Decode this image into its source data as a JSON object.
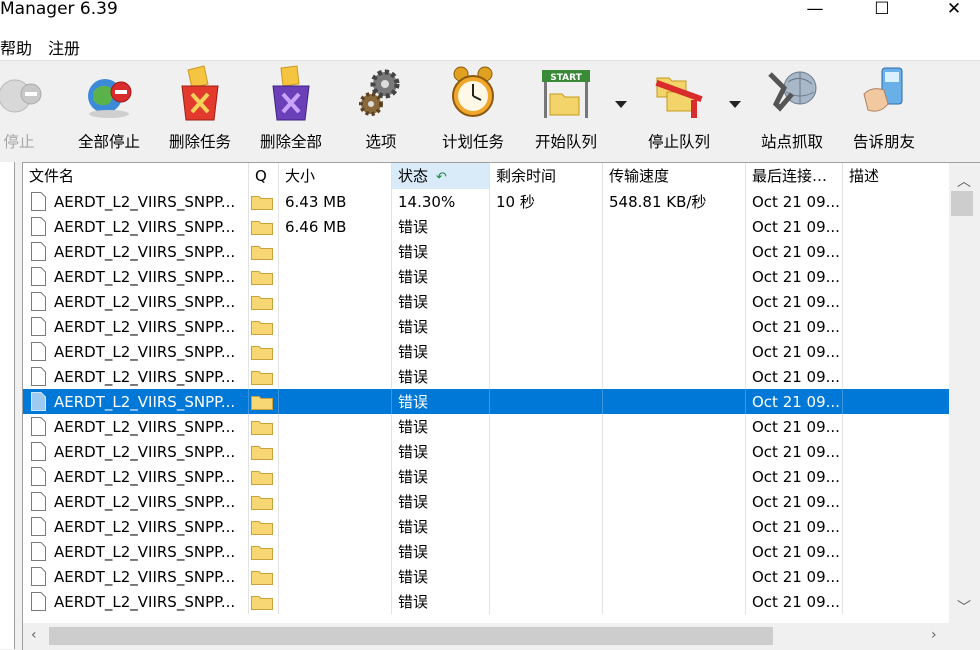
{
  "window": {
    "title": "Manager 6.39",
    "minimize": "—",
    "maximize": "☐",
    "close": "✕"
  },
  "menu": [
    "帮助",
    "注册"
  ],
  "toolbar": [
    {
      "label": "停止",
      "icon": "stop-icon",
      "enabled": false
    },
    {
      "label": "全部停止",
      "icon": "stop-all-icon",
      "enabled": true
    },
    {
      "label": "删除任务",
      "icon": "delete-task-icon",
      "enabled": true
    },
    {
      "label": "删除全部",
      "icon": "delete-all-icon",
      "enabled": true
    },
    {
      "label": "选项",
      "icon": "gear-icon",
      "enabled": true
    },
    {
      "label": "计划任务",
      "icon": "alarm-clock-icon",
      "enabled": true
    },
    {
      "label": "开始队列",
      "icon": "start-queue-icon",
      "enabled": true,
      "icon_text": "START"
    },
    {
      "label": "停止队列",
      "icon": "stop-queue-icon",
      "enabled": true
    },
    {
      "label": "站点抓取",
      "icon": "site-grabber-icon",
      "enabled": true
    },
    {
      "label": "告诉朋友",
      "icon": "tell-friend-icon",
      "enabled": true
    }
  ],
  "columns": [
    "文件名",
    "Q",
    "大小",
    "状态",
    "剩余时间",
    "传输速度",
    "最后连接…",
    "描述"
  ],
  "rows": [
    {
      "name": "AERDT_L2_VIIRS_SNPP...",
      "size": "6.43  MB",
      "status": "14.30%",
      "remaining": "10 秒",
      "speed": "548.81  KB/秒",
      "last": "Oct 21 09...",
      "desc": "",
      "selected": false
    },
    {
      "name": "AERDT_L2_VIIRS_SNPP...",
      "size": "6.46  MB",
      "status": "错误",
      "remaining": "",
      "speed": "",
      "last": "Oct 21 09...",
      "desc": "",
      "selected": false
    },
    {
      "name": "AERDT_L2_VIIRS_SNPP...",
      "size": "",
      "status": "错误",
      "remaining": "",
      "speed": "",
      "last": "Oct 21 09...",
      "desc": "",
      "selected": false
    },
    {
      "name": "AERDT_L2_VIIRS_SNPP...",
      "size": "",
      "status": "错误",
      "remaining": "",
      "speed": "",
      "last": "Oct 21 09...",
      "desc": "",
      "selected": false
    },
    {
      "name": "AERDT_L2_VIIRS_SNPP...",
      "size": "",
      "status": "错误",
      "remaining": "",
      "speed": "",
      "last": "Oct 21 09...",
      "desc": "",
      "selected": false
    },
    {
      "name": "AERDT_L2_VIIRS_SNPP...",
      "size": "",
      "status": "错误",
      "remaining": "",
      "speed": "",
      "last": "Oct 21 09...",
      "desc": "",
      "selected": false
    },
    {
      "name": "AERDT_L2_VIIRS_SNPP...",
      "size": "",
      "status": "错误",
      "remaining": "",
      "speed": "",
      "last": "Oct 21 09...",
      "desc": "",
      "selected": false
    },
    {
      "name": "AERDT_L2_VIIRS_SNPP...",
      "size": "",
      "status": "错误",
      "remaining": "",
      "speed": "",
      "last": "Oct 21 09...",
      "desc": "",
      "selected": false
    },
    {
      "name": "AERDT_L2_VIIRS_SNPP...",
      "size": "",
      "status": "错误",
      "remaining": "",
      "speed": "",
      "last": "Oct 21 09...",
      "desc": "",
      "selected": true
    },
    {
      "name": "AERDT_L2_VIIRS_SNPP...",
      "size": "",
      "status": "错误",
      "remaining": "",
      "speed": "",
      "last": "Oct 21 09...",
      "desc": "",
      "selected": false
    },
    {
      "name": "AERDT_L2_VIIRS_SNPP...",
      "size": "",
      "status": "错误",
      "remaining": "",
      "speed": "",
      "last": "Oct 21 09...",
      "desc": "",
      "selected": false
    },
    {
      "name": "AERDT_L2_VIIRS_SNPP...",
      "size": "",
      "status": "错误",
      "remaining": "",
      "speed": "",
      "last": "Oct 21 09...",
      "desc": "",
      "selected": false
    },
    {
      "name": "AERDT_L2_VIIRS_SNPP...",
      "size": "",
      "status": "错误",
      "remaining": "",
      "speed": "",
      "last": "Oct 21 09...",
      "desc": "",
      "selected": false
    },
    {
      "name": "AERDT_L2_VIIRS_SNPP...",
      "size": "",
      "status": "错误",
      "remaining": "",
      "speed": "",
      "last": "Oct 21 09...",
      "desc": "",
      "selected": false
    },
    {
      "name": "AERDT_L2_VIIRS_SNPP...",
      "size": "",
      "status": "错误",
      "remaining": "",
      "speed": "",
      "last": "Oct 21 09...",
      "desc": "",
      "selected": false
    },
    {
      "name": "AERDT_L2_VIIRS_SNPP...",
      "size": "",
      "status": "错误",
      "remaining": "",
      "speed": "",
      "last": "Oct 21 09...",
      "desc": "",
      "selected": false
    },
    {
      "name": "AERDT_L2_VIIRS_SNPP...",
      "size": "",
      "status": "错误",
      "remaining": "",
      "speed": "",
      "last": "Oct 21 09...",
      "desc": "",
      "selected": false
    }
  ],
  "colors": {
    "selection": "#0078d7",
    "sorted_header": "#d9ebf9",
    "folder": "#f7d774"
  }
}
